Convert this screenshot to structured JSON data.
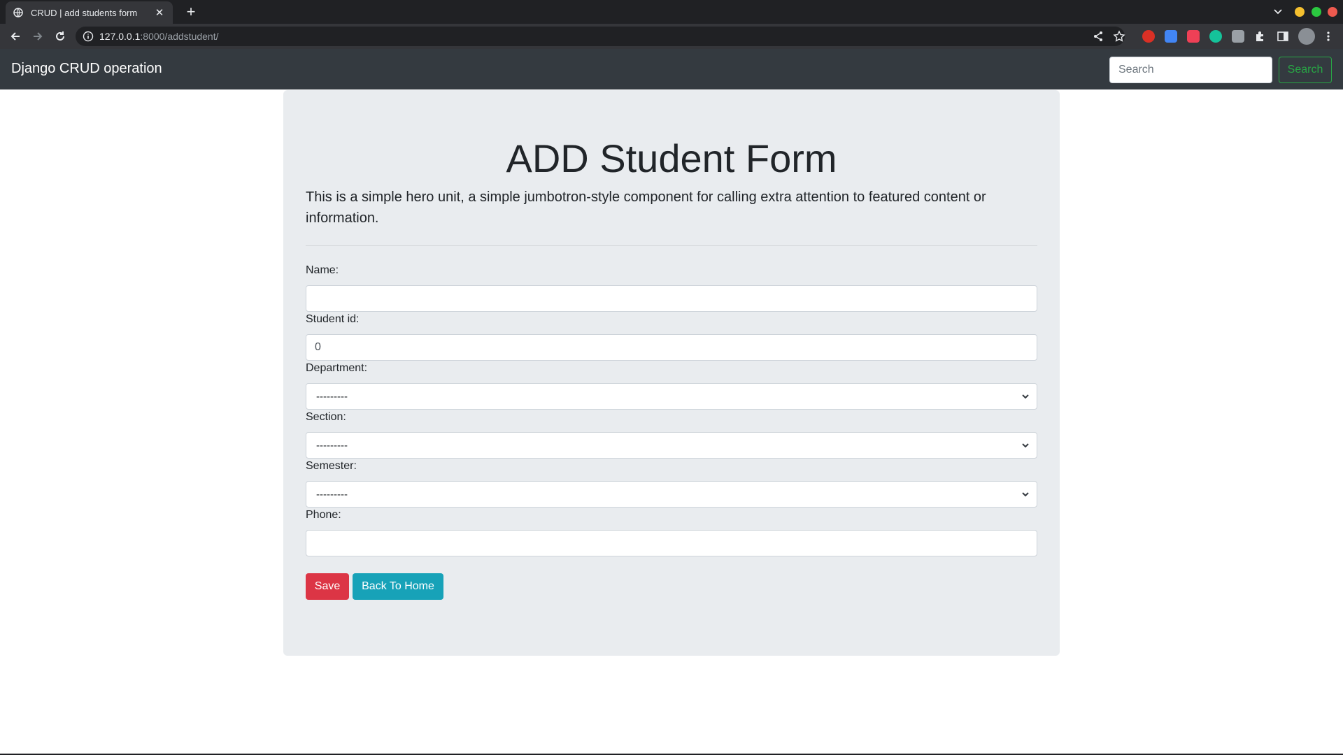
{
  "browser": {
    "tab_title": "CRUD | add students form",
    "url_host": "127.0.0.1",
    "url_path": ":8000/addstudent/",
    "icons": [
      "globe-icon",
      "close-icon",
      "plus-icon",
      "back-arrow-icon",
      "forward-arrow-icon",
      "reload-icon",
      "info-icon",
      "share-icon",
      "star-icon",
      "extensions-puzzle-icon",
      "profile-avatar"
    ]
  },
  "navbar": {
    "brand": "Django CRUD operation",
    "search_placeholder": "Search",
    "search_button": "Search"
  },
  "page": {
    "title": "ADD Student Form",
    "lead": "This is a simple hero unit, a simple jumbotron-style component for calling extra attention to featured content or information."
  },
  "form": {
    "name_label": "Name:",
    "name_value": "",
    "student_id_label": "Student id:",
    "student_id_value": "0",
    "department_label": "Department:",
    "department_selected": "---------",
    "section_label": "Section:",
    "section_selected": "---------",
    "semester_label": "Semester:",
    "semester_selected": "---------",
    "phone_label": "Phone:",
    "phone_value": "",
    "save_label": "Save",
    "back_label": "Back To Home"
  },
  "colors": {
    "navbar_bg": "#343a40",
    "jumbotron_bg": "#e9ecef",
    "save_btn": "#dc3545",
    "home_btn": "#17a2b8",
    "search_btn": "#28a745"
  }
}
